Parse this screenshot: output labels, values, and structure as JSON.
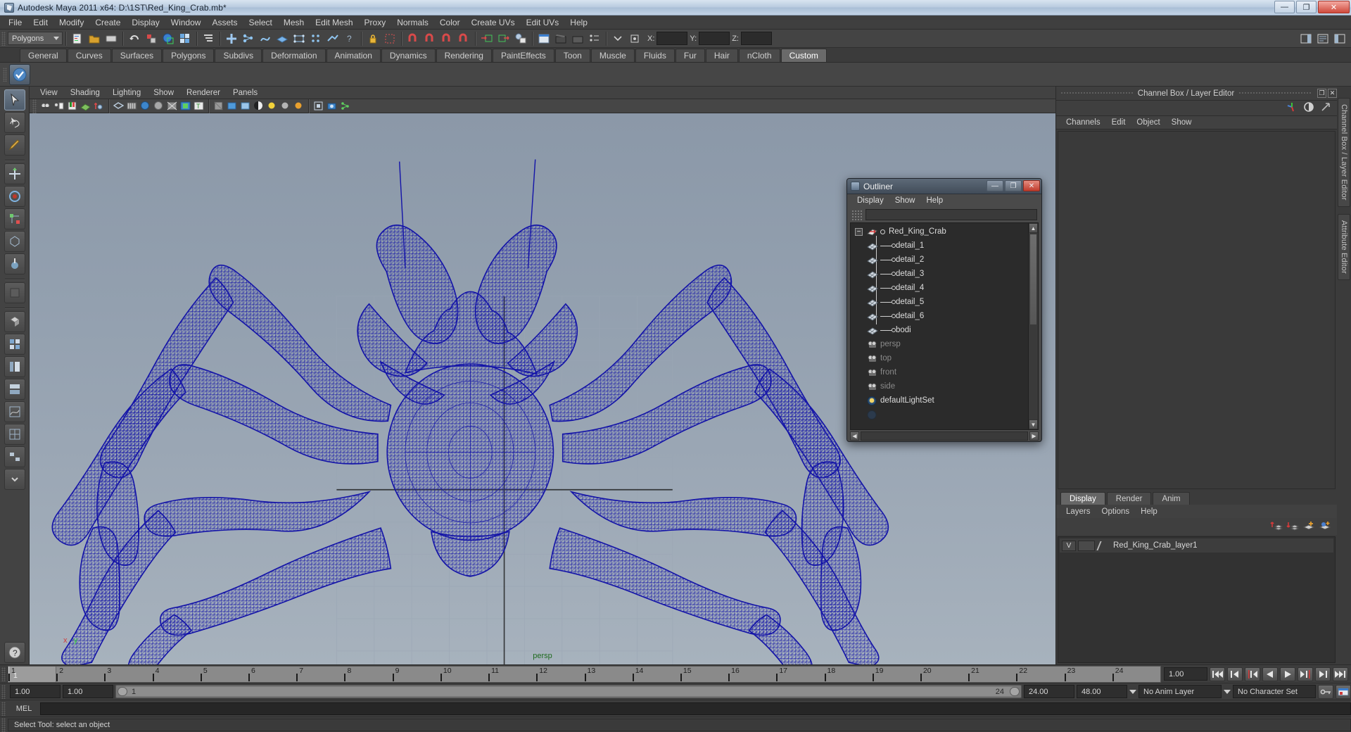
{
  "window": {
    "title": "Autodesk Maya 2011 x64: D:\\1ST\\Red_King_Crab.mb*",
    "minimize": "—",
    "maximize": "❐",
    "close": "✕"
  },
  "menubar": {
    "items": [
      "File",
      "Edit",
      "Modify",
      "Create",
      "Display",
      "Window",
      "Assets",
      "Select",
      "Mesh",
      "Edit Mesh",
      "Proxy",
      "Normals",
      "Color",
      "Create UVs",
      "Edit UVs",
      "Help"
    ]
  },
  "statusbar": {
    "mode_selector": "Polygons",
    "x_label": "X:",
    "y_label": "Y:",
    "z_label": "Z:",
    "x_value": "",
    "y_value": "",
    "z_value": ""
  },
  "shelf": {
    "tabs": [
      "General",
      "Curves",
      "Surfaces",
      "Polygons",
      "Subdivs",
      "Deformation",
      "Animation",
      "Dynamics",
      "Rendering",
      "PaintEffects",
      "Toon",
      "Muscle",
      "Fluids",
      "Fur",
      "Hair",
      "nCloth",
      "Custom"
    ],
    "active_tab": "Custom"
  },
  "viewport": {
    "menu": [
      "View",
      "Shading",
      "Lighting",
      "Show",
      "Renderer",
      "Panels"
    ],
    "camera_label": "persp",
    "axis_x": "x",
    "axis_y": "y",
    "axis_z": "z"
  },
  "outliner": {
    "title": "Outliner",
    "menu": [
      "Display",
      "Show",
      "Help"
    ],
    "search_value": "",
    "search_placeholder": "",
    "minimize": "—",
    "maximize": "❐",
    "close": "✕",
    "collapse_glyph": "−",
    "root": "Red_King_Crab",
    "children": [
      "detail_1",
      "detail_2",
      "detail_3",
      "detail_4",
      "detail_5",
      "detail_6",
      "bodi"
    ],
    "cameras": [
      "persp",
      "top",
      "front",
      "side"
    ],
    "sets": [
      "defaultLightSet"
    ]
  },
  "channelbox": {
    "panel_title": "Channel Box / Layer Editor",
    "menu": [
      "Channels",
      "Edit",
      "Object",
      "Show"
    ],
    "side_tabs": [
      "Channel Box / Layer Editor",
      "Attribute Editor"
    ],
    "float_glyph": "❐",
    "close_glyph": "✕"
  },
  "layer_editor": {
    "tabs": [
      "Display",
      "Render",
      "Anim"
    ],
    "active_tab": "Display",
    "menu": [
      "Layers",
      "Options",
      "Help"
    ],
    "layers": [
      {
        "visibility": "V",
        "display_type": "",
        "name": "Red_King_Crab_layer1"
      }
    ]
  },
  "timeslider": {
    "ticks": [
      "1",
      "2",
      "3",
      "4",
      "5",
      "6",
      "7",
      "8",
      "9",
      "10",
      "11",
      "12",
      "13",
      "14",
      "15",
      "16",
      "17",
      "18",
      "19",
      "20",
      "21",
      "22",
      "23",
      "24"
    ],
    "current_frame": "1",
    "current_frame_field": "1.00"
  },
  "rangeslider": {
    "anim_start": "1.00",
    "range_start": "1.00",
    "range_end": "24.00",
    "anim_end": "48.00",
    "range_label": "1",
    "range_end_label": "24",
    "anim_layer": "No Anim Layer",
    "character_set": "No Character Set"
  },
  "command_line": {
    "language_label": "MEL",
    "command_value": ""
  },
  "status_message": "Select Tool: select an object",
  "colors": {
    "wireframe": "#1515a8",
    "accent_green": "#1f6b1f",
    "titlebar_text": "#1a2430",
    "panel_bg": "#3d3d3d",
    "viewport_top": "#8b98a8",
    "viewport_bottom": "#a7b2bd"
  }
}
